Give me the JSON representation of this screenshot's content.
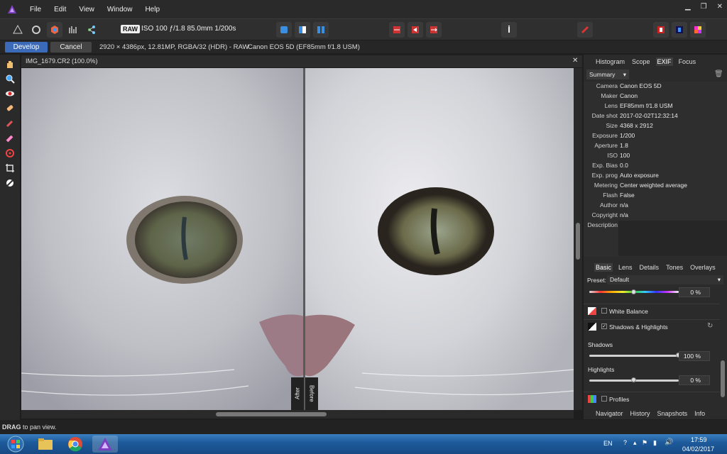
{
  "menu": {
    "items": [
      "File",
      "Edit",
      "View",
      "Window",
      "Help"
    ]
  },
  "toolbar": {
    "raw_badge": "RAW",
    "camera_settings": "ISO 100 ƒ/1.8 85.0mm 1/200s"
  },
  "context": {
    "develop_label": "Develop",
    "cancel_label": "Cancel",
    "image_info": "2920 × 4386px, 12.81MP, RGBA/32 (HDR) - RAW",
    "camera_lens": "Canon EOS 5D (EF85mm f/1.8 USM)"
  },
  "document": {
    "title": "IMG_1679.CR2 (100.0%)",
    "after_label": "After",
    "before_label": "Before"
  },
  "panel_top": {
    "tabs": [
      "Histogram",
      "Scope",
      "EXIF",
      "Focus"
    ],
    "active_tab": "EXIF",
    "dropdown": "Summary",
    "exif": [
      {
        "k": "Camera",
        "v": "Canon EOS 5D"
      },
      {
        "k": "Maker",
        "v": "Canon"
      },
      {
        "k": "Lens",
        "v": "EF85mm f/1.8 USM"
      },
      {
        "k": "Date shot",
        "v": "2017-02-02T12:32:14"
      },
      {
        "k": "Size",
        "v": "4368 x 2912"
      },
      {
        "k": "Exposure",
        "v": "1/200"
      },
      {
        "k": "Aperture",
        "v": "1.8"
      },
      {
        "k": "ISO",
        "v": "100"
      },
      {
        "k": "Exp. Bias",
        "v": "0.0"
      },
      {
        "k": "Exp. prog",
        "v": "Auto exposure"
      },
      {
        "k": "Metering",
        "v": "Center weighted average"
      },
      {
        "k": "Flash",
        "v": "False"
      },
      {
        "k": "Author",
        "v": "n/a"
      },
      {
        "k": "Copyright",
        "v": "n/a"
      },
      {
        "k": "Description",
        "v": ""
      }
    ]
  },
  "panel_bottom": {
    "tabs": [
      "Basic",
      "Lens",
      "Details",
      "Tones",
      "Overlays"
    ],
    "active_tab": "Basic",
    "preset_label": "Preset:",
    "preset_value": "Default",
    "hue_value": "0 %",
    "hue_level": 0.5,
    "white_balance": "White Balance",
    "shadows_highlights": "Shadows & Highlights",
    "shadows_label": "Shadows",
    "shadows_value": "100 %",
    "shadows_level": 1.0,
    "highlights_label": "Highlights",
    "highlights_value": "0 %",
    "highlights_level": 0.5,
    "profiles": "Profiles"
  },
  "panel_footer": {
    "tabs": [
      "Navigator",
      "History",
      "Snapshots",
      "Info"
    ]
  },
  "status": {
    "bold": "DRAG",
    "text": " to pan view."
  },
  "taskbar": {
    "lang": "EN",
    "time": "17:59",
    "date": "04/02/2017"
  },
  "colors": {
    "accent": "#3b6bb8",
    "bg": "#1e1e1e",
    "panel": "#2b2b2b"
  }
}
